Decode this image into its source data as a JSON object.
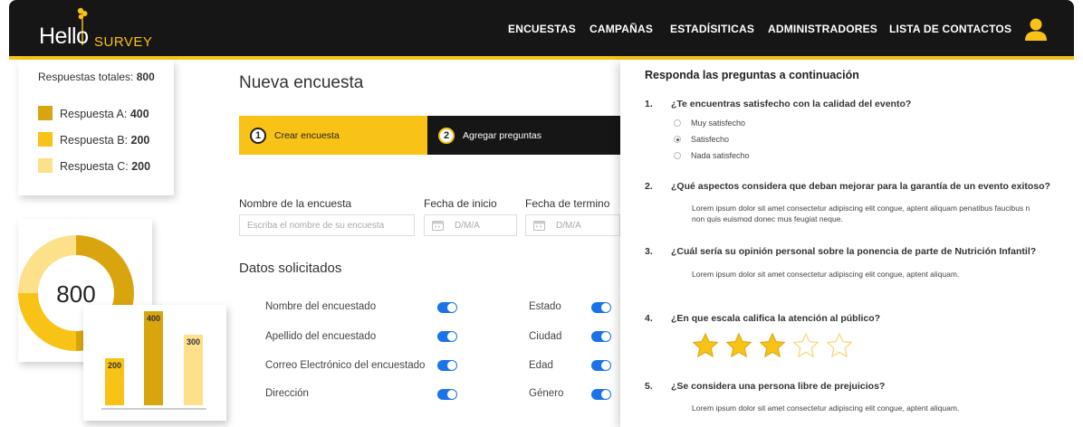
{
  "header": {
    "logo_hello": "Hello",
    "logo_survey": "SURVEY",
    "nav": [
      "ENCUESTAS",
      "CAMPAÑAS",
      "ESTADÍSITICAS",
      "ADMINISTRADORES",
      "LISTA DE CONTACTOS"
    ],
    "active_nav": "ENCUESTAS",
    "user_icon": "user-icon",
    "colors": {
      "bar": "#161616",
      "accent": "#f9c217"
    }
  },
  "stats": {
    "total_label": "Respuestas totales:",
    "total_value": "800",
    "legend": [
      {
        "label": "Respuesta A:",
        "value": "400",
        "color": "#d9a50f"
      },
      {
        "label": "Respuesta B:",
        "value": "200",
        "color": "#f9c217"
      },
      {
        "label": "Respuesta C:",
        "value": "200",
        "color": "#fde08a"
      }
    ]
  },
  "donut": {
    "center_label": "800",
    "segments": [
      400,
      200,
      200
    ]
  },
  "chart_data": {
    "type": "bar",
    "categories": [
      "",
      "",
      ""
    ],
    "values": [
      200,
      400,
      300
    ],
    "data_labels": [
      "200",
      "400",
      "300"
    ],
    "colors": [
      "#f9c217",
      "#d9a50f",
      "#fde08a"
    ],
    "ylim": [
      0,
      400
    ]
  },
  "form": {
    "title": "Nueva encuesta",
    "steps": [
      {
        "num": "1",
        "label": "Crear encuesta"
      },
      {
        "num": "2",
        "label": "Agregar preguntas"
      }
    ],
    "name_label": "Nombre de la encuesta",
    "name_placeholder": "Escriba el nombre de su encuesta",
    "start_label": "Fecha de inicio",
    "start_placeholder": "D/M/A",
    "end_label": "Fecha de termino",
    "end_placeholder": "D/M/A",
    "section_title": "Datos solicitados",
    "toggles_left": [
      "Nombre del encuestado",
      "Apellido del encuestado",
      "Correo Electrónico del encuestado",
      "Dirección"
    ],
    "toggles_right": [
      "Estado",
      "Ciudad",
      "Edad",
      "Género"
    ]
  },
  "preview": {
    "title": "Responda las preguntas a continuación",
    "questions": [
      {
        "num": "1.",
        "text": "¿Te encuentras satisfecho con la calidad del evento?"
      },
      {
        "num": "2.",
        "text": "¿Qué aspectos considera que deban mejorar para la garantía de un evento exitoso?"
      },
      {
        "num": "3.",
        "text": "¿Cuál sería su opinión personal sobre la ponencia de parte de Nutrición Infantil?"
      },
      {
        "num": "4.",
        "text": "¿En que escala califica la atención al público?"
      },
      {
        "num": "5.",
        "text": "¿Se considera una persona libre de prejuicios?"
      }
    ],
    "q1_options": [
      "Muy satisfecho",
      "Satisfecho",
      "Nada satisfecho"
    ],
    "q1_selected": "Satisfecho",
    "q2_answer_lines": [
      "Lorem ipsum dolor sit amet consectetur adipiscing elit congue, aptent aliquam penatibus faucibus n",
      "non quis euismod donec mus feugiat neque."
    ],
    "q3_answer": "Lorem ipsum dolor sit amet consectetur adipiscing elit congue, aptent aliquam.",
    "q4_rating": 3,
    "q4_max": 5,
    "q5_answer": "Lorem ipsum dolor sit amet consectetur adipiscing elit congue, aptent aliquam."
  }
}
